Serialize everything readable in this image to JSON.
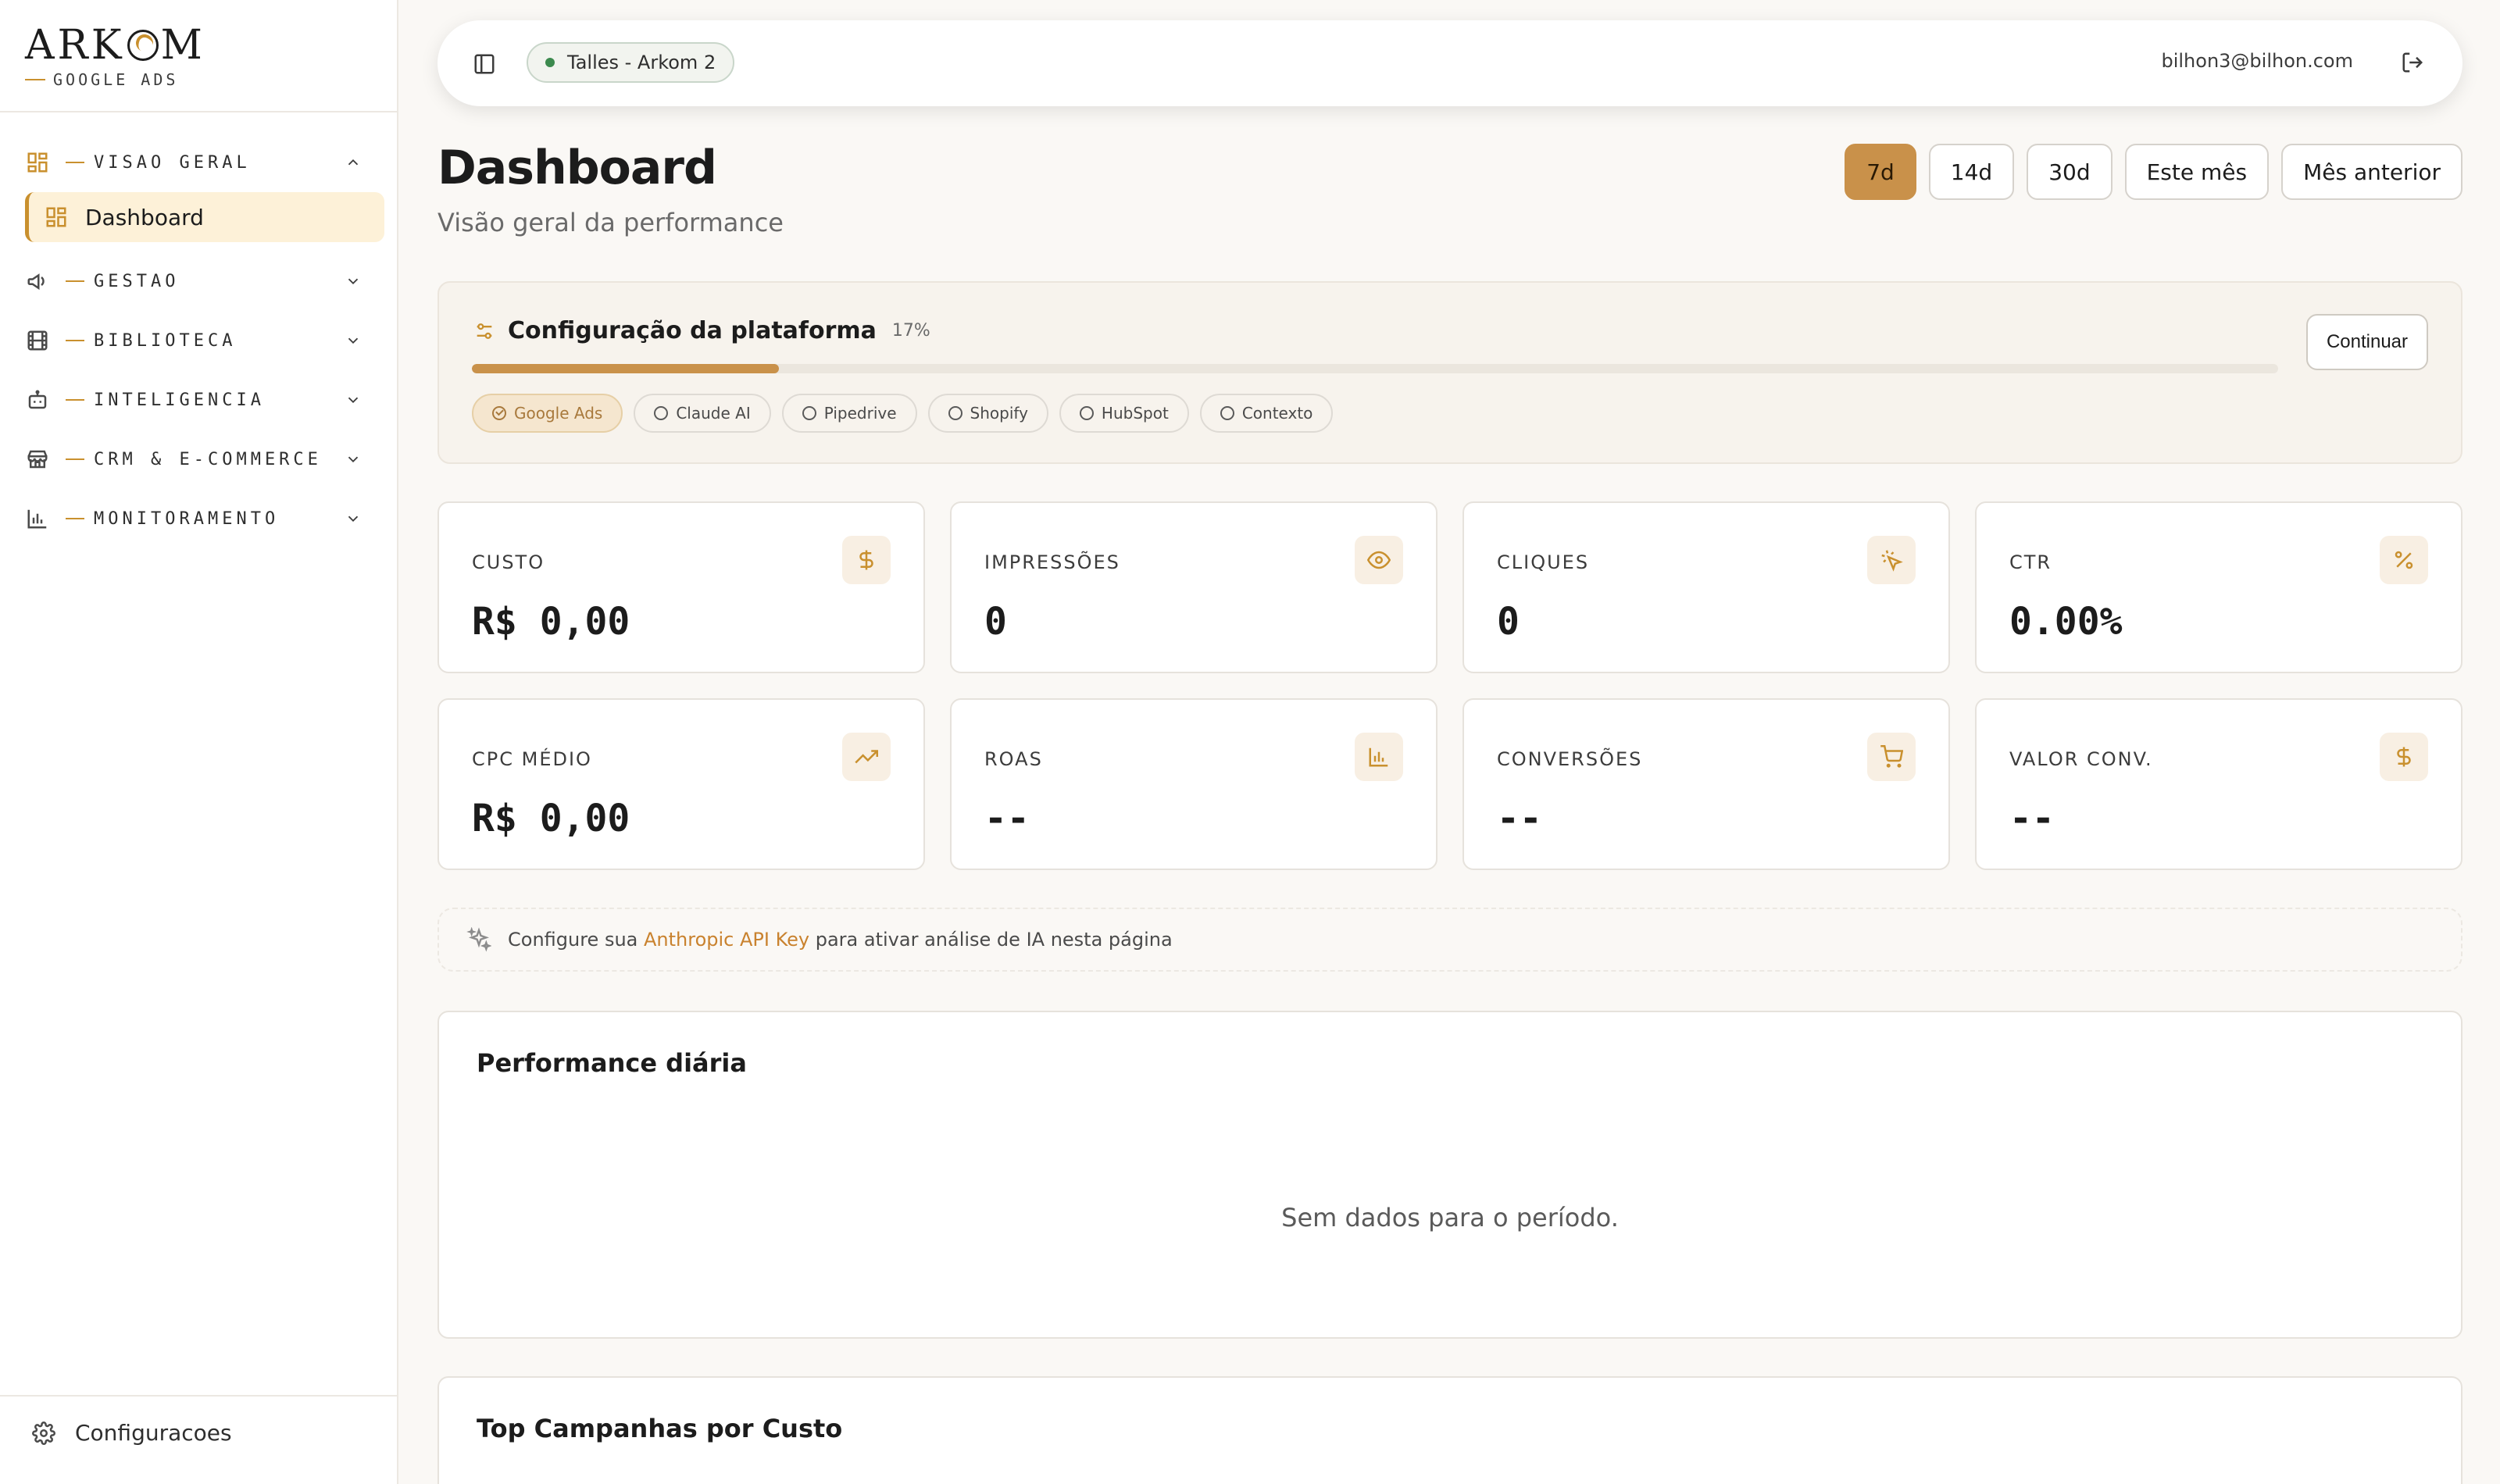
{
  "brand": {
    "name_prefix": "ARK",
    "name_suffix": "M",
    "subtitle": "GOOGLE ADS"
  },
  "sidebar": {
    "groups": [
      {
        "label": "VISAO GERAL",
        "icon": "layout-grid-icon",
        "expanded": true,
        "items": [
          {
            "label": "Dashboard",
            "icon": "layout-grid-icon",
            "active": true
          }
        ]
      },
      {
        "label": "GESTAO",
        "icon": "megaphone-icon",
        "expanded": false
      },
      {
        "label": "BIBLIOTECA",
        "icon": "film-icon",
        "expanded": false
      },
      {
        "label": "INTELIGENCIA",
        "icon": "bot-icon",
        "expanded": false
      },
      {
        "label": "CRM & E-COMMERCE",
        "icon": "store-icon",
        "expanded": false
      },
      {
        "label": "MONITORAMENTO",
        "icon": "bar-chart-icon",
        "expanded": false
      }
    ],
    "settings_label": "Configuracoes"
  },
  "topbar": {
    "account": "Talles - Arkom 2",
    "account_status_color": "#3c8a4e",
    "user_email": "bilhon3@bilhon.com"
  },
  "header": {
    "title": "Dashboard",
    "subtitle": "Visão geral da performance",
    "ranges": [
      {
        "label": "7d",
        "active": true
      },
      {
        "label": "14d",
        "active": false
      },
      {
        "label": "30d",
        "active": false
      },
      {
        "label": "Este mês",
        "active": false
      },
      {
        "label": "Mês anterior",
        "active": false
      }
    ]
  },
  "setup": {
    "title": "Configuração da plataforma",
    "percent_label": "17%",
    "progress": 0.17,
    "continue_label": "Continuar",
    "steps": [
      {
        "label": "Google Ads",
        "done": true
      },
      {
        "label": "Claude AI",
        "done": false
      },
      {
        "label": "Pipedrive",
        "done": false
      },
      {
        "label": "Shopify",
        "done": false
      },
      {
        "label": "HubSpot",
        "done": false
      },
      {
        "label": "Contexto",
        "done": false
      }
    ]
  },
  "kpis": [
    {
      "label": "CUSTO",
      "value": "R$ 0,00",
      "icon": "dollar-icon"
    },
    {
      "label": "IMPRESSÕES",
      "value": "0",
      "icon": "eye-icon"
    },
    {
      "label": "CLIQUES",
      "value": "0",
      "icon": "pointer-click-icon"
    },
    {
      "label": "CTR",
      "value": "0.00%",
      "icon": "percent-icon"
    },
    {
      "label": "CPC MÉDIO",
      "value": "R$ 0,00",
      "icon": "trending-up-icon"
    },
    {
      "label": "ROAS",
      "value": "--",
      "icon": "bar-chart-icon"
    },
    {
      "label": "CONVERSÕES",
      "value": "--",
      "icon": "cart-icon"
    },
    {
      "label": "VALOR CONV.",
      "value": "--",
      "icon": "dollar-icon"
    }
  ],
  "ai_notice": {
    "prefix": "Configure sua ",
    "link": "Anthropic API Key",
    "suffix": " para ativar análise de IA nesta página"
  },
  "daily": {
    "title": "Performance diária",
    "empty": "Sem dados para o período."
  },
  "top_campaigns": {
    "title": "Top Campanhas por Custo"
  },
  "colors": {
    "accent": "#c9914a",
    "accent_dark": "#c9902e",
    "active_nav_bg": "#fdf1d8"
  }
}
